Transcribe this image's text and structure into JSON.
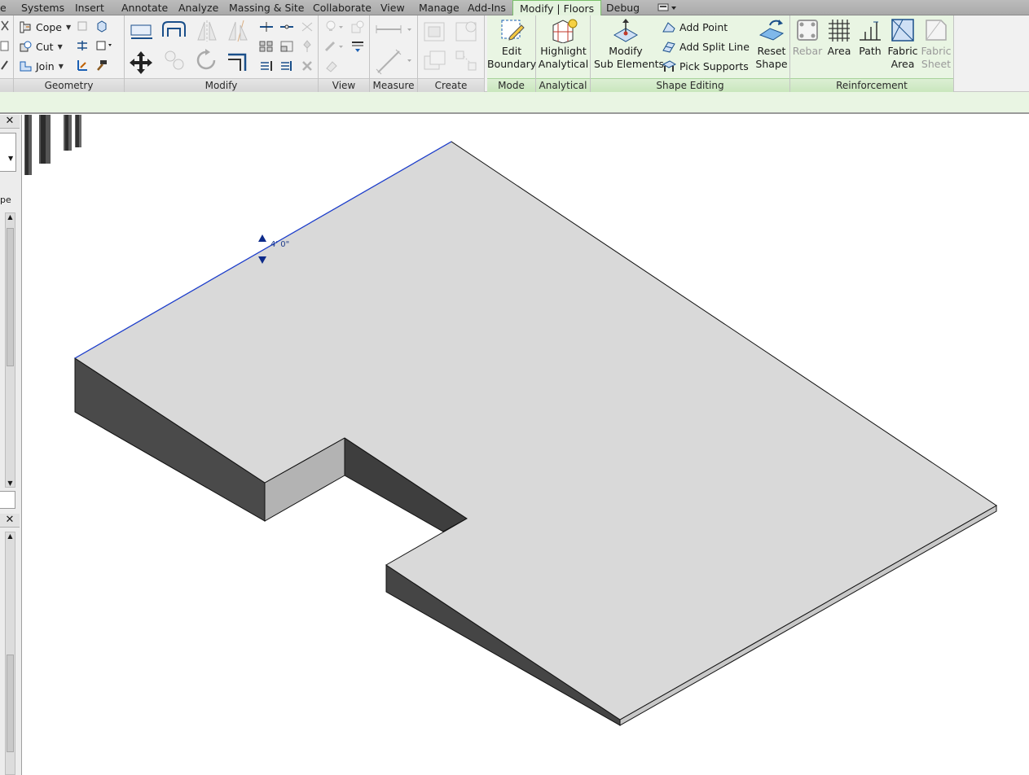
{
  "tabs": [
    {
      "label": "e"
    },
    {
      "label": "Systems"
    },
    {
      "label": "Insert"
    },
    {
      "label": "Annotate"
    },
    {
      "label": "Analyze"
    },
    {
      "label": "Massing & Site"
    },
    {
      "label": "Collaborate"
    },
    {
      "label": "View"
    },
    {
      "label": "Manage"
    },
    {
      "label": "Add-Ins"
    },
    {
      "label": "Modify | Floors",
      "active": true
    },
    {
      "label": "Debug"
    }
  ],
  "ribbon": {
    "panels": {
      "geometry": "Geometry",
      "modify": "Modify",
      "view": "View",
      "measure": "Measure",
      "create": "Create",
      "mode": "Mode",
      "analytical": "Analytical",
      "shape_editing": "Shape Editing",
      "reinforcement": "Reinforcement"
    },
    "geometry": {
      "cope": "Cope",
      "cut": "Cut",
      "join": "Join"
    },
    "mode": {
      "edit_boundary_1": "Edit",
      "edit_boundary_2": "Boundary"
    },
    "analytical": {
      "highlight_1": "Highlight",
      "highlight_2": "Analytical"
    },
    "shape_editing": {
      "modify_sub_1": "Modify",
      "modify_sub_2": "Sub Elements",
      "add_point": "Add Point",
      "add_split_line": "Add Split Line",
      "pick_supports": "Pick Supports",
      "reset_1": "Reset",
      "reset_2": "Shape"
    },
    "reinforcement": {
      "rebar": "Rebar",
      "area": "Area",
      "path": "Path",
      "fabric_area_1": "Fabric",
      "fabric_area_2": "Area",
      "fabric_sheet_1": "Fabric",
      "fabric_sheet_2": "Sheet"
    }
  },
  "left_dock": {
    "properties_fragment": "pe"
  },
  "viewport": {
    "dimension_label": "4' 0\""
  },
  "colors": {
    "ribbon_bg": "#f1f1f1",
    "contextual_green": "#e9f5e3",
    "floor_top": "#d9d9d9",
    "floor_side_dark": "#4a4a4a",
    "floor_side_light": "#b3b3b3",
    "selection_blue": "#1c3fd6"
  }
}
